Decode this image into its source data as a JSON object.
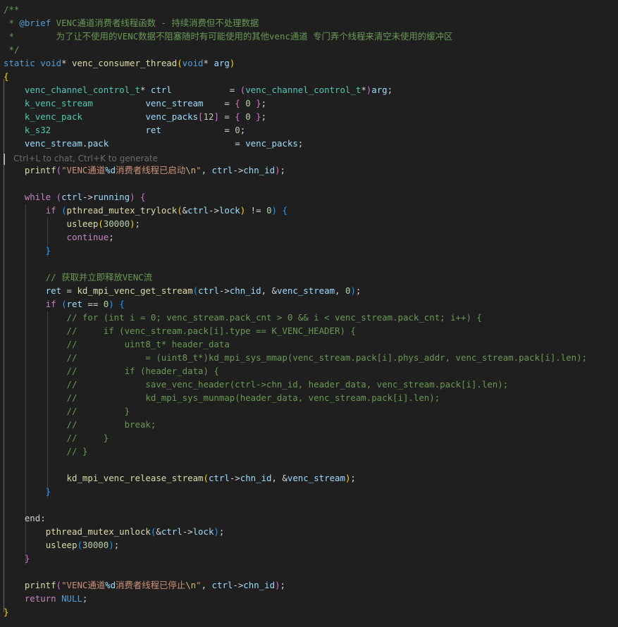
{
  "editor": {
    "language": "c",
    "inline_hint": "Ctrl+L to chat, Ctrl+K to generate",
    "theme": {
      "default": "#d4d4d4",
      "comment": "#6a9955",
      "keyword": "#569cd6",
      "control": "#c586c0",
      "type": "#4ec9b0",
      "function": "#dcdcaa",
      "variable": "#9cdcfe",
      "string": "#ce9178",
      "number": "#b5cea8",
      "doc_tag": "#569cd6",
      "bracket_gold": "#ffd700",
      "bracket_purple": "#da70d6",
      "bracket_blue": "#179fff",
      "escape": "#d7ba7d"
    },
    "lines": [
      [
        [
          "/**",
          "comment"
        ]
      ],
      [
        [
          " * ",
          "comment"
        ],
        [
          "@brief",
          "doc_tag"
        ],
        [
          " VENC通道消费者线程函数 - 持续消费但不处理数据",
          "comment"
        ]
      ],
      [
        [
          " *        为了让不使用的VENC数据不阻塞随时有可能使用的其他venc通道 专门弄个线程来清空未使用的缓冲区",
          "comment"
        ]
      ],
      [
        [
          " */",
          "comment"
        ]
      ],
      [
        [
          "static",
          "keyword"
        ],
        [
          " ",
          "default"
        ],
        [
          "void",
          "keyword"
        ],
        [
          "* ",
          "default"
        ],
        [
          "venc_consumer_thread",
          "function"
        ],
        [
          "(",
          "bracket_gold"
        ],
        [
          "void",
          "keyword"
        ],
        [
          "* ",
          "default"
        ],
        [
          "arg",
          "variable"
        ],
        [
          ")",
          "bracket_gold"
        ]
      ],
      [
        [
          "{",
          "bracket_gold"
        ]
      ],
      [
        [
          "    ",
          "default"
        ],
        [
          "venc_channel_control_t",
          "type"
        ],
        [
          "* ",
          "default"
        ],
        [
          "ctrl",
          "variable"
        ],
        [
          "           = ",
          "default"
        ],
        [
          "(",
          "bracket_purple"
        ],
        [
          "venc_channel_control_t",
          "type"
        ],
        [
          "*",
          "default"
        ],
        [
          ")",
          "bracket_purple"
        ],
        [
          "arg",
          "variable"
        ],
        [
          ";",
          "default"
        ]
      ],
      [
        [
          "    ",
          "default"
        ],
        [
          "k_venc_stream",
          "type"
        ],
        [
          "          ",
          "default"
        ],
        [
          "venc_stream",
          "variable"
        ],
        [
          "    = ",
          "default"
        ],
        [
          "{",
          "bracket_purple"
        ],
        [
          " ",
          "default"
        ],
        [
          "0",
          "number"
        ],
        [
          " ",
          "default"
        ],
        [
          "}",
          "bracket_purple"
        ],
        [
          ";",
          "default"
        ]
      ],
      [
        [
          "    ",
          "default"
        ],
        [
          "k_venc_pack",
          "type"
        ],
        [
          "            ",
          "default"
        ],
        [
          "venc_packs",
          "variable"
        ],
        [
          "[",
          "bracket_purple"
        ],
        [
          "12",
          "number"
        ],
        [
          "]",
          "bracket_purple"
        ],
        [
          " = ",
          "default"
        ],
        [
          "{",
          "bracket_purple"
        ],
        [
          " ",
          "default"
        ],
        [
          "0",
          "number"
        ],
        [
          " ",
          "default"
        ],
        [
          "}",
          "bracket_purple"
        ],
        [
          ";",
          "default"
        ]
      ],
      [
        [
          "    ",
          "default"
        ],
        [
          "k_s32",
          "type"
        ],
        [
          "                  ",
          "default"
        ],
        [
          "ret",
          "variable"
        ],
        [
          "            = ",
          "default"
        ],
        [
          "0",
          "number"
        ],
        [
          ";",
          "default"
        ]
      ],
      [
        [
          "    ",
          "default"
        ],
        [
          "venc_stream",
          "variable"
        ],
        [
          ".",
          "default"
        ],
        [
          "pack",
          "variable"
        ],
        [
          "                        = ",
          "default"
        ],
        [
          "venc_packs",
          "variable"
        ],
        [
          ";",
          "default"
        ]
      ],
      [],
      [
        [
          "    ",
          "default"
        ],
        [
          "printf",
          "function"
        ],
        [
          "(",
          "bracket_purple"
        ],
        [
          "\"VENC通道",
          "string"
        ],
        [
          "%d",
          "variable"
        ],
        [
          "消费者线程已启动",
          "string"
        ],
        [
          "\\n",
          "escape"
        ],
        [
          "\"",
          "string"
        ],
        [
          ", ",
          "default"
        ],
        [
          "ctrl",
          "variable"
        ],
        [
          "->",
          "default"
        ],
        [
          "chn_id",
          "variable"
        ],
        [
          ")",
          "bracket_purple"
        ],
        [
          ";",
          "default"
        ]
      ],
      [],
      [
        [
          "    ",
          "default"
        ],
        [
          "while",
          "control"
        ],
        [
          " ",
          "default"
        ],
        [
          "(",
          "bracket_purple"
        ],
        [
          "ctrl",
          "variable"
        ],
        [
          "->",
          "default"
        ],
        [
          "running",
          "variable"
        ],
        [
          ")",
          "bracket_purple"
        ],
        [
          " ",
          "default"
        ],
        [
          "{",
          "bracket_purple"
        ]
      ],
      [
        [
          "        ",
          "default"
        ],
        [
          "if",
          "control"
        ],
        [
          " ",
          "default"
        ],
        [
          "(",
          "bracket_blue"
        ],
        [
          "pthread_mutex_trylock",
          "function"
        ],
        [
          "(",
          "bracket_gold"
        ],
        [
          "&",
          "default"
        ],
        [
          "ctrl",
          "variable"
        ],
        [
          "->",
          "default"
        ],
        [
          "lock",
          "variable"
        ],
        [
          ")",
          "bracket_gold"
        ],
        [
          " != ",
          "default"
        ],
        [
          "0",
          "number"
        ],
        [
          ")",
          "bracket_blue"
        ],
        [
          " ",
          "default"
        ],
        [
          "{",
          "bracket_blue"
        ]
      ],
      [
        [
          "            ",
          "default"
        ],
        [
          "usleep",
          "function"
        ],
        [
          "(",
          "bracket_gold"
        ],
        [
          "30000",
          "number"
        ],
        [
          ")",
          "bracket_gold"
        ],
        [
          ";",
          "default"
        ]
      ],
      [
        [
          "            ",
          "default"
        ],
        [
          "continue",
          "control"
        ],
        [
          ";",
          "default"
        ]
      ],
      [
        [
          "        ",
          "default"
        ],
        [
          "}",
          "bracket_blue"
        ]
      ],
      [],
      [
        [
          "        ",
          "default"
        ],
        [
          "// 获取并立即释放VENC流",
          "comment"
        ]
      ],
      [
        [
          "        ",
          "default"
        ],
        [
          "ret",
          "variable"
        ],
        [
          " = ",
          "default"
        ],
        [
          "kd_mpi_venc_get_stream",
          "function"
        ],
        [
          "(",
          "bracket_blue"
        ],
        [
          "ctrl",
          "variable"
        ],
        [
          "->",
          "default"
        ],
        [
          "chn_id",
          "variable"
        ],
        [
          ", &",
          "default"
        ],
        [
          "venc_stream",
          "variable"
        ],
        [
          ", ",
          "default"
        ],
        [
          "0",
          "number"
        ],
        [
          ")",
          "bracket_blue"
        ],
        [
          ";",
          "default"
        ]
      ],
      [
        [
          "        ",
          "default"
        ],
        [
          "if",
          "control"
        ],
        [
          " ",
          "default"
        ],
        [
          "(",
          "bracket_blue"
        ],
        [
          "ret",
          "variable"
        ],
        [
          " == ",
          "default"
        ],
        [
          "0",
          "number"
        ],
        [
          ")",
          "bracket_blue"
        ],
        [
          " ",
          "default"
        ],
        [
          "{",
          "bracket_blue"
        ]
      ],
      [
        [
          "            ",
          "default"
        ],
        [
          "// for (int i = 0; venc_stream.pack_cnt > 0 && i < venc_stream.pack_cnt; i++) {",
          "comment"
        ]
      ],
      [
        [
          "            ",
          "default"
        ],
        [
          "//     if (venc_stream.pack[i].type == K_VENC_HEADER) {",
          "comment"
        ]
      ],
      [
        [
          "            ",
          "default"
        ],
        [
          "//         uint8_t* header_data",
          "comment"
        ]
      ],
      [
        [
          "            ",
          "default"
        ],
        [
          "//             = (uint8_t*)kd_mpi_sys_mmap(venc_stream.pack[i].phys_addr, venc_stream.pack[i].len);",
          "comment"
        ]
      ],
      [
        [
          "            ",
          "default"
        ],
        [
          "//         if (header_data) {",
          "comment"
        ]
      ],
      [
        [
          "            ",
          "default"
        ],
        [
          "//             save_venc_header(ctrl->chn_id, header_data, venc_stream.pack[i].len);",
          "comment"
        ]
      ],
      [
        [
          "            ",
          "default"
        ],
        [
          "//             kd_mpi_sys_munmap(header_data, venc_stream.pack[i].len);",
          "comment"
        ]
      ],
      [
        [
          "            ",
          "default"
        ],
        [
          "//         }",
          "comment"
        ]
      ],
      [
        [
          "            ",
          "default"
        ],
        [
          "//         break;",
          "comment"
        ]
      ],
      [
        [
          "            ",
          "default"
        ],
        [
          "//     }",
          "comment"
        ]
      ],
      [
        [
          "            ",
          "default"
        ],
        [
          "// }",
          "comment"
        ]
      ],
      [],
      [
        [
          "            ",
          "default"
        ],
        [
          "kd_mpi_venc_release_stream",
          "function"
        ],
        [
          "(",
          "bracket_gold"
        ],
        [
          "ctrl",
          "variable"
        ],
        [
          "->",
          "default"
        ],
        [
          "chn_id",
          "variable"
        ],
        [
          ", &",
          "default"
        ],
        [
          "venc_stream",
          "variable"
        ],
        [
          ")",
          "bracket_gold"
        ],
        [
          ";",
          "default"
        ]
      ],
      [
        [
          "        ",
          "default"
        ],
        [
          "}",
          "bracket_blue"
        ]
      ],
      [],
      [
        [
          "    ",
          "default"
        ],
        [
          "end",
          "default"
        ],
        [
          ":",
          "default"
        ]
      ],
      [
        [
          "        ",
          "default"
        ],
        [
          "pthread_mutex_unlock",
          "function"
        ],
        [
          "(",
          "bracket_blue"
        ],
        [
          "&",
          "default"
        ],
        [
          "ctrl",
          "variable"
        ],
        [
          "->",
          "default"
        ],
        [
          "lock",
          "variable"
        ],
        [
          ")",
          "bracket_blue"
        ],
        [
          ";",
          "default"
        ]
      ],
      [
        [
          "        ",
          "default"
        ],
        [
          "usleep",
          "function"
        ],
        [
          "(",
          "bracket_blue"
        ],
        [
          "30000",
          "number"
        ],
        [
          ")",
          "bracket_blue"
        ],
        [
          ";",
          "default"
        ]
      ],
      [
        [
          "    ",
          "default"
        ],
        [
          "}",
          "bracket_purple"
        ]
      ],
      [],
      [
        [
          "    ",
          "default"
        ],
        [
          "printf",
          "function"
        ],
        [
          "(",
          "bracket_purple"
        ],
        [
          "\"VENC通道",
          "string"
        ],
        [
          "%d",
          "variable"
        ],
        [
          "消费者线程已停止",
          "string"
        ],
        [
          "\\n",
          "escape"
        ],
        [
          "\"",
          "string"
        ],
        [
          ", ",
          "default"
        ],
        [
          "ctrl",
          "variable"
        ],
        [
          "->",
          "default"
        ],
        [
          "chn_id",
          "variable"
        ],
        [
          ")",
          "bracket_purple"
        ],
        [
          ";",
          "default"
        ]
      ],
      [
        [
          "    ",
          "default"
        ],
        [
          "return",
          "control"
        ],
        [
          " ",
          "default"
        ],
        [
          "NULL",
          "keyword"
        ],
        [
          ";",
          "default"
        ]
      ],
      [
        [
          "}",
          "bracket_gold"
        ]
      ]
    ]
  }
}
